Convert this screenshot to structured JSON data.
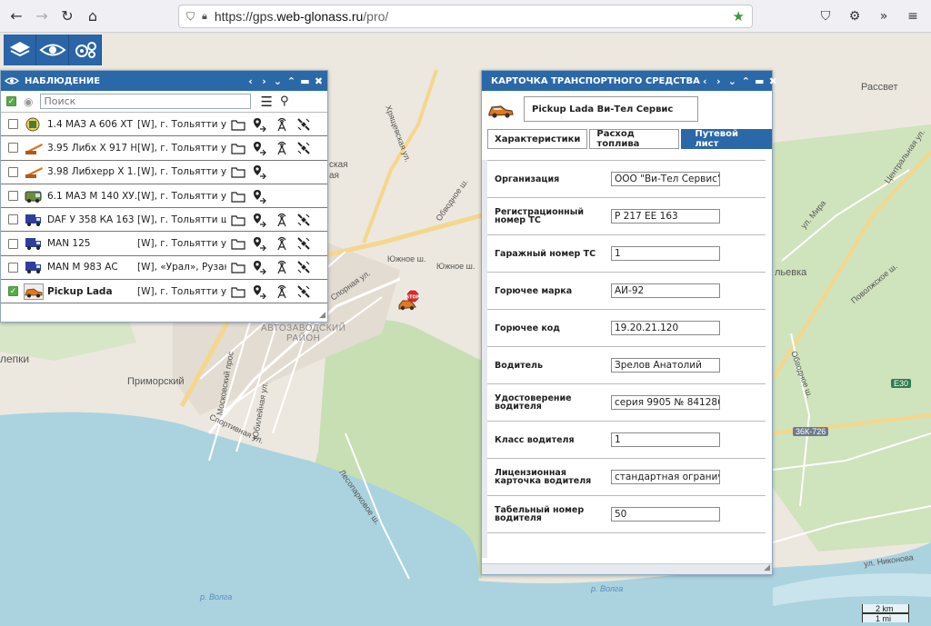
{
  "browser": {
    "url_prefix": "https://gps.",
    "url_domain": "web-glonass.ru",
    "url_path": "/pro/"
  },
  "map": {
    "labels": {
      "raion": "АВТОЗАВОДСКИЙ\nРАЙОН",
      "primorsky": "Приморский",
      "lepki": "лепки",
      "rassvet": "Рассвет",
      "lvevka": "льевка",
      "volga": "р. Волга",
      "yuzhnoe1": "Южное ш.",
      "yuzhnoe2": "Южное ш.",
      "obvodnoe": "Обводное ш.",
      "kaya": "ская",
      "yskaya": "ая",
      "moskovsky": "Московский прос",
      "yubileynaya": "Юбилейная ул.",
      "sportivnaya": "Спортивная ул.",
      "lesoparkovoe": "Лесопарковое ш.",
      "primorsky_b": "Приморский бул.",
      "tsentralnaya": "Центральная ул.",
      "ul_mira": "ул. Мира",
      "povolzhskoe": "Поволжское ш.",
      "obvodnoe2": "Обводное ш.",
      "nikonova": "ул. Никонова",
      "khrebtovskaya": "Хрящевская ул.",
      "zhilaya": "Спорная ул."
    },
    "badge_e30": "E30",
    "badge_36k": "36К-726",
    "scale_km": "2 km",
    "scale_mi": "1 mi",
    "colors": {
      "water": "#aad3df",
      "forest": "#c8dfb4",
      "road_major": "#f4d78c",
      "bg": "#ece8df"
    }
  },
  "toolbar": {
    "icons": [
      "layers-icon",
      "eye-icon",
      "settings-gears-icon"
    ]
  },
  "observation": {
    "title": "НАБЛЮДЕНИЕ",
    "search_placeholder": "Поиск",
    "vehicles": [
      {
        "name": "1.4 МАЗ А 606 ХТ ...",
        "location": "[W], г. Тольятти у...",
        "icon": "tank-truck-icon",
        "checked": false,
        "actions": 4
      },
      {
        "name": "3.95 Либх Х 917 Н...",
        "location": "[W], г. Тольятти у...",
        "icon": "crane-icon",
        "checked": false,
        "actions": 4
      },
      {
        "name": "3.98 Либхерр Х 1...",
        "location": "[W], г. Тольятти у...",
        "icon": "crane-icon",
        "checked": false,
        "actions": 2
      },
      {
        "name": "6.1 МАЗ М 140 ХУ...",
        "location": "[W], г. Тольятти у...",
        "icon": "van-icon",
        "checked": false,
        "actions": 2
      },
      {
        "name": "DAF У 358 КА 163",
        "location": "[W], г. Тольятти ш...",
        "icon": "truck-icon",
        "checked": false,
        "actions": 4
      },
      {
        "name": "MAN 125",
        "location": "[W], г. Тольятти у...",
        "icon": "truck-icon",
        "checked": false,
        "actions": 4
      },
      {
        "name": "MAN М 983 АС",
        "location": "[W], «Урал», Рузан...",
        "icon": "truck-icon",
        "checked": false,
        "actions": 4
      },
      {
        "name": "Pickup Lada",
        "location": "[W], г. Тольятти у...",
        "icon": "pickup-icon",
        "checked": true,
        "actions": 4,
        "selected": true
      }
    ]
  },
  "card": {
    "title": "КАРТОЧКА ТРАНСПОРТНОГО СРЕДСТВА",
    "vehicle_name": "Pickup Lada Ви-Тел Сервис",
    "tabs": [
      "Характеристики",
      "Расход топлива",
      "Путевой лист"
    ],
    "active_tab": 2,
    "fields": [
      {
        "label": "Организация",
        "value": "ООО \"Ви-Тел Сервис\""
      },
      {
        "label": "Регистрационный номер ТС",
        "value": "Р 217 ЕЕ 163"
      },
      {
        "label": "Гаражный номер ТС",
        "value": "1"
      },
      {
        "label": "Горючее марка",
        "value": "АИ-92"
      },
      {
        "label": "Горючее код",
        "value": "19.20.21.120"
      },
      {
        "label": "Водитель",
        "value": "Зрелов Анатолий"
      },
      {
        "label": "Удостоверение водителя",
        "value": "серия 9905 № 841286"
      },
      {
        "label": "Класс водителя",
        "value": "1"
      },
      {
        "label": "Лицензионная карточка водителя",
        "value": "стандартная ограничен"
      },
      {
        "label": "Табельный номер водителя",
        "value": "50"
      }
    ]
  }
}
